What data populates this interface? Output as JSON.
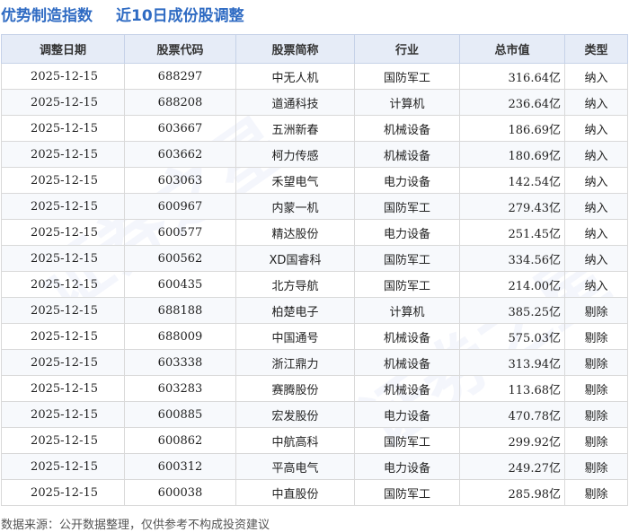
{
  "header": {
    "title_part1": "优势制造指数",
    "title_part2": "近10日成份股调整"
  },
  "table": {
    "columns": [
      "调整日期",
      "股票代码",
      "股票简称",
      "行业",
      "总市值",
      "类型"
    ],
    "rows": [
      {
        "date": "2025-12-15",
        "code": "688297",
        "name": "中无人机",
        "industry": "国防军工",
        "cap": "316.64亿",
        "type": "纳入"
      },
      {
        "date": "2025-12-15",
        "code": "688208",
        "name": "道通科技",
        "industry": "计算机",
        "cap": "236.64亿",
        "type": "纳入"
      },
      {
        "date": "2025-12-15",
        "code": "603667",
        "name": "五洲新春",
        "industry": "机械设备",
        "cap": "186.69亿",
        "type": "纳入"
      },
      {
        "date": "2025-12-15",
        "code": "603662",
        "name": "柯力传感",
        "industry": "机械设备",
        "cap": "180.69亿",
        "type": "纳入"
      },
      {
        "date": "2025-12-15",
        "code": "603063",
        "name": "禾望电气",
        "industry": "电力设备",
        "cap": "142.54亿",
        "type": "纳入"
      },
      {
        "date": "2025-12-15",
        "code": "600967",
        "name": "内蒙一机",
        "industry": "国防军工",
        "cap": "279.43亿",
        "type": "纳入"
      },
      {
        "date": "2025-12-15",
        "code": "600577",
        "name": "精达股份",
        "industry": "电力设备",
        "cap": "251.45亿",
        "type": "纳入"
      },
      {
        "date": "2025-12-15",
        "code": "600562",
        "name": "XD国睿科",
        "industry": "国防军工",
        "cap": "334.56亿",
        "type": "纳入"
      },
      {
        "date": "2025-12-15",
        "code": "600435",
        "name": "北方导航",
        "industry": "国防军工",
        "cap": "214.00亿",
        "type": "纳入"
      },
      {
        "date": "2025-12-15",
        "code": "688188",
        "name": "柏楚电子",
        "industry": "计算机",
        "cap": "385.25亿",
        "type": "剔除"
      },
      {
        "date": "2025-12-15",
        "code": "688009",
        "name": "中国通号",
        "industry": "机械设备",
        "cap": "575.03亿",
        "type": "剔除"
      },
      {
        "date": "2025-12-15",
        "code": "603338",
        "name": "浙江鼎力",
        "industry": "机械设备",
        "cap": "313.94亿",
        "type": "剔除"
      },
      {
        "date": "2025-12-15",
        "code": "603283",
        "name": "赛腾股份",
        "industry": "机械设备",
        "cap": "113.68亿",
        "type": "剔除"
      },
      {
        "date": "2025-12-15",
        "code": "600885",
        "name": "宏发股份",
        "industry": "电力设备",
        "cap": "470.78亿",
        "type": "剔除"
      },
      {
        "date": "2025-12-15",
        "code": "600862",
        "name": "中航高科",
        "industry": "国防军工",
        "cap": "299.92亿",
        "type": "剔除"
      },
      {
        "date": "2025-12-15",
        "code": "600312",
        "name": "平高电气",
        "industry": "电力设备",
        "cap": "249.27亿",
        "type": "剔除"
      },
      {
        "date": "2025-12-15",
        "code": "600038",
        "name": "中直股份",
        "industry": "国防军工",
        "cap": "285.98亿",
        "type": "剔除"
      }
    ]
  },
  "watermark": [
    "证券之星",
    "证券之星"
  ],
  "footer": {
    "source_note": "数据来源：公开数据整理，仅供参考不构成投资建议"
  }
}
